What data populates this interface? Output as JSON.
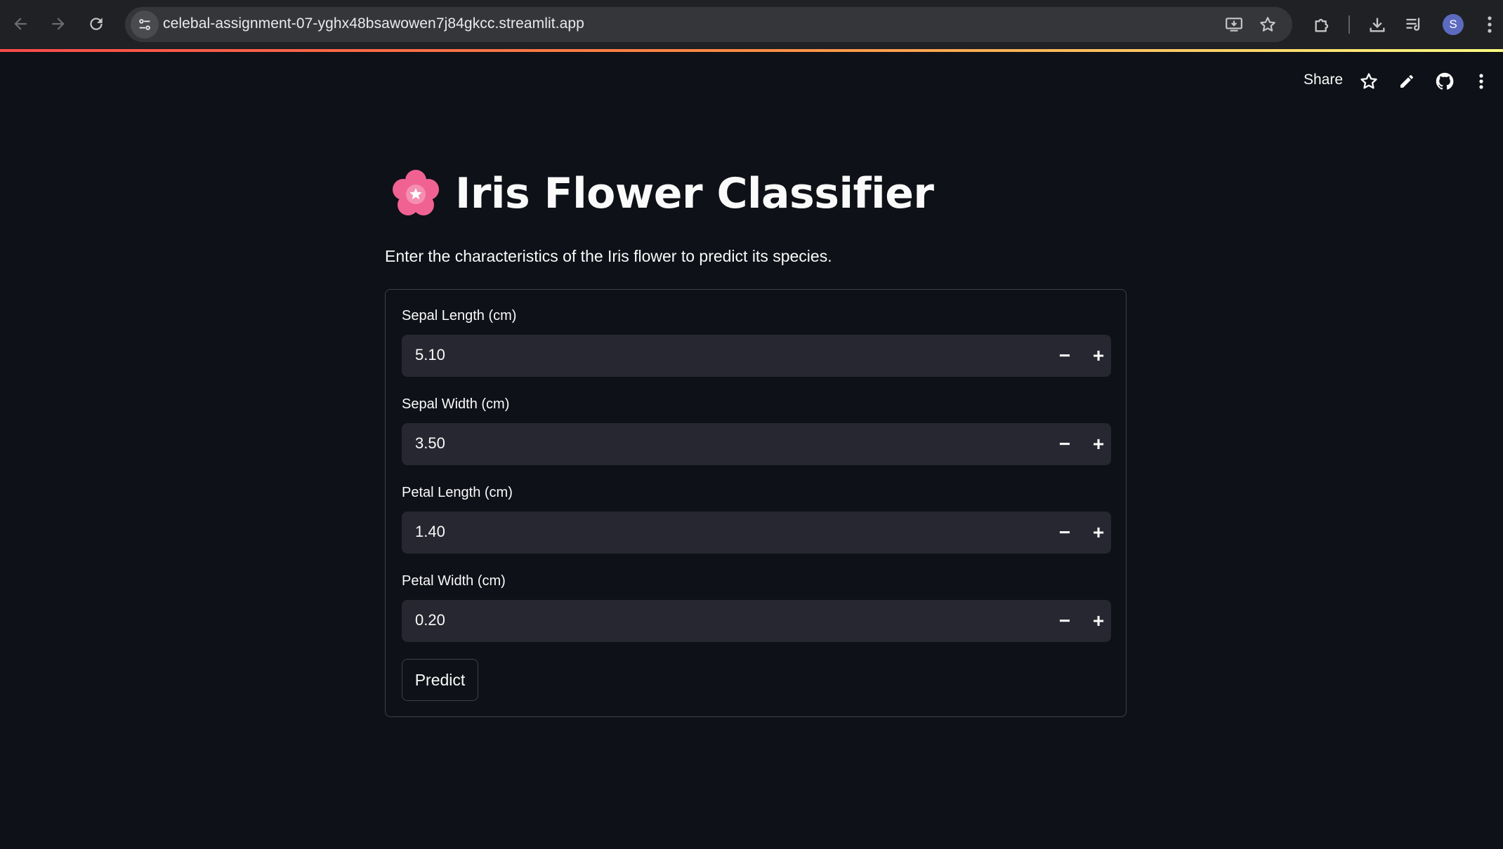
{
  "browser": {
    "url": "celebal-assignment-07-yghx48bsawowen7j84gkcc.streamlit.app",
    "avatar_letter": "S",
    "icons": [
      "back-icon",
      "forward-icon",
      "reload-icon",
      "site-info-icon",
      "install-app-icon",
      "bookmark-star-icon",
      "extensions-icon",
      "downloads-icon",
      "reading-list-icon",
      "menu-icon"
    ]
  },
  "streamlit_header": {
    "share_label": "Share",
    "icons": [
      "star-icon",
      "edit-icon",
      "github-icon",
      "more-icon"
    ]
  },
  "app": {
    "title": "Iris Flower Classifier",
    "title_icon": "cherry-blossom-icon",
    "subtitle": "Enter the characteristics of the Iris flower to predict its species.",
    "fields": [
      {
        "label": "Sepal Length (cm)",
        "value": "5.10"
      },
      {
        "label": "Sepal Width (cm)",
        "value": "3.50"
      },
      {
        "label": "Petal Length (cm)",
        "value": "1.40"
      },
      {
        "label": "Petal Width (cm)",
        "value": "0.20"
      }
    ],
    "minus_symbol": "−",
    "plus_symbol": "+",
    "predict_label": "Predict"
  },
  "colors": {
    "background": "#0e1117",
    "input_bg": "#262730",
    "accent_red": "#ff4b4b",
    "avatar": "#5c6bc0"
  }
}
